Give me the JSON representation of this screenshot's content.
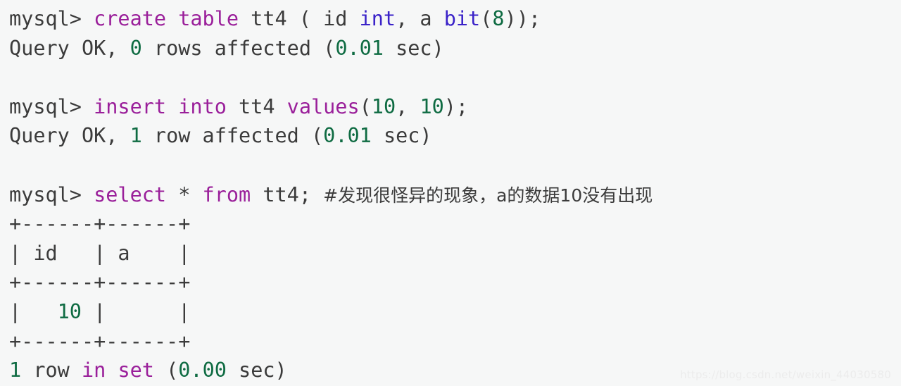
{
  "terminal": {
    "background_color": "#f6f7f7",
    "foreground_color": "#3b3b3b",
    "keyword_color": "#9a1f9a",
    "type_color": "#3a22c8",
    "number_color": "#0e6b42",
    "prompt": "mysql>",
    "lines": [
      {
        "id": "line-1-create",
        "kind": "command",
        "text": "mysql> create table tt4 ( id int, a bit(8));",
        "segments": [
          {
            "text": "mysql> ",
            "token": "plain"
          },
          {
            "text": "create table",
            "token": "keyword"
          },
          {
            "text": " tt4 ( id ",
            "token": "plain"
          },
          {
            "text": "int",
            "token": "type"
          },
          {
            "text": ", a ",
            "token": "plain"
          },
          {
            "text": "bit",
            "token": "type"
          },
          {
            "text": "(",
            "token": "plain"
          },
          {
            "text": "8",
            "token": "number"
          },
          {
            "text": "));",
            "token": "plain"
          }
        ]
      },
      {
        "id": "line-2-result",
        "kind": "result",
        "text": "Query OK, 0 rows affected (0.01 sec)",
        "segments": [
          {
            "text": "Query OK, ",
            "token": "plain"
          },
          {
            "text": "0",
            "token": "number"
          },
          {
            "text": " rows affected (",
            "token": "plain"
          },
          {
            "text": "0.01",
            "token": "number"
          },
          {
            "text": " sec)",
            "token": "plain"
          }
        ]
      },
      {
        "id": "line-3-blank",
        "kind": "blank",
        "text": " ",
        "segments": [
          {
            "text": " ",
            "token": "plain"
          }
        ]
      },
      {
        "id": "line-4-insert",
        "kind": "command",
        "text": "mysql> insert into tt4 values(10, 10);",
        "segments": [
          {
            "text": "mysql> ",
            "token": "plain"
          },
          {
            "text": "insert into",
            "token": "keyword"
          },
          {
            "text": " tt4 ",
            "token": "plain"
          },
          {
            "text": "values",
            "token": "keyword"
          },
          {
            "text": "(",
            "token": "plain"
          },
          {
            "text": "10",
            "token": "number"
          },
          {
            "text": ", ",
            "token": "plain"
          },
          {
            "text": "10",
            "token": "number"
          },
          {
            "text": ");",
            "token": "plain"
          }
        ]
      },
      {
        "id": "line-5-result",
        "kind": "result",
        "text": "Query OK, 1 row affected (0.01 sec)",
        "segments": [
          {
            "text": "Query OK, ",
            "token": "plain"
          },
          {
            "text": "1",
            "token": "number"
          },
          {
            "text": " row affected (",
            "token": "plain"
          },
          {
            "text": "0.01",
            "token": "number"
          },
          {
            "text": " sec)",
            "token": "plain"
          }
        ]
      },
      {
        "id": "line-6-blank",
        "kind": "blank",
        "text": " ",
        "segments": [
          {
            "text": " ",
            "token": "plain"
          }
        ]
      },
      {
        "id": "line-7-select",
        "kind": "command",
        "text": "mysql> select * from tt4; #发现很怪异的现象，a的数据10没有出现",
        "segments": [
          {
            "text": "mysql> ",
            "token": "plain"
          },
          {
            "text": "select",
            "token": "keyword"
          },
          {
            "text": " * ",
            "token": "plain"
          },
          {
            "text": "from",
            "token": "keyword"
          },
          {
            "text": " tt4; ",
            "token": "plain"
          },
          {
            "text": "#发现很怪异的现象，a的数据10没有出现",
            "token": "cjk-comment"
          }
        ]
      },
      {
        "id": "line-8-table-top-border",
        "kind": "table-border",
        "text": "+------+------+",
        "segments": [
          {
            "text": "+------+------+",
            "token": "plain"
          }
        ]
      },
      {
        "id": "line-9-table-header",
        "kind": "table-header",
        "text": "| id   | a    |",
        "segments": [
          {
            "text": "| id   | a    |",
            "token": "plain"
          }
        ]
      },
      {
        "id": "line-10-table-mid-border",
        "kind": "table-border",
        "text": "+------+------+",
        "segments": [
          {
            "text": "+------+------+",
            "token": "plain"
          }
        ]
      },
      {
        "id": "line-11-table-row",
        "kind": "table-row",
        "text": "|   10 |      |",
        "segments": [
          {
            "text": "|   ",
            "token": "plain"
          },
          {
            "text": "10",
            "token": "number"
          },
          {
            "text": " |      |",
            "token": "plain"
          }
        ]
      },
      {
        "id": "line-12-table-bottom-border",
        "kind": "table-border",
        "text": "+------+------+",
        "segments": [
          {
            "text": "+------+------+",
            "token": "plain"
          }
        ]
      },
      {
        "id": "line-13-result",
        "kind": "result",
        "text": "1 row in set (0.00 sec)",
        "segments": [
          {
            "text": "1",
            "token": "number"
          },
          {
            "text": " row ",
            "token": "plain"
          },
          {
            "text": "in set",
            "token": "keyword"
          },
          {
            "text": " (",
            "token": "plain"
          },
          {
            "text": "0.00",
            "token": "number"
          },
          {
            "text": " sec)",
            "token": "plain"
          }
        ]
      }
    ],
    "result_table": {
      "columns": [
        "id",
        "a"
      ],
      "rows": [
        {
          "id": "10",
          "a": ""
        }
      ],
      "row_count_text": "1 row in set (0.00 sec)"
    }
  },
  "watermark": {
    "text": "https://blog.csdn.net/weixin_44030580"
  }
}
